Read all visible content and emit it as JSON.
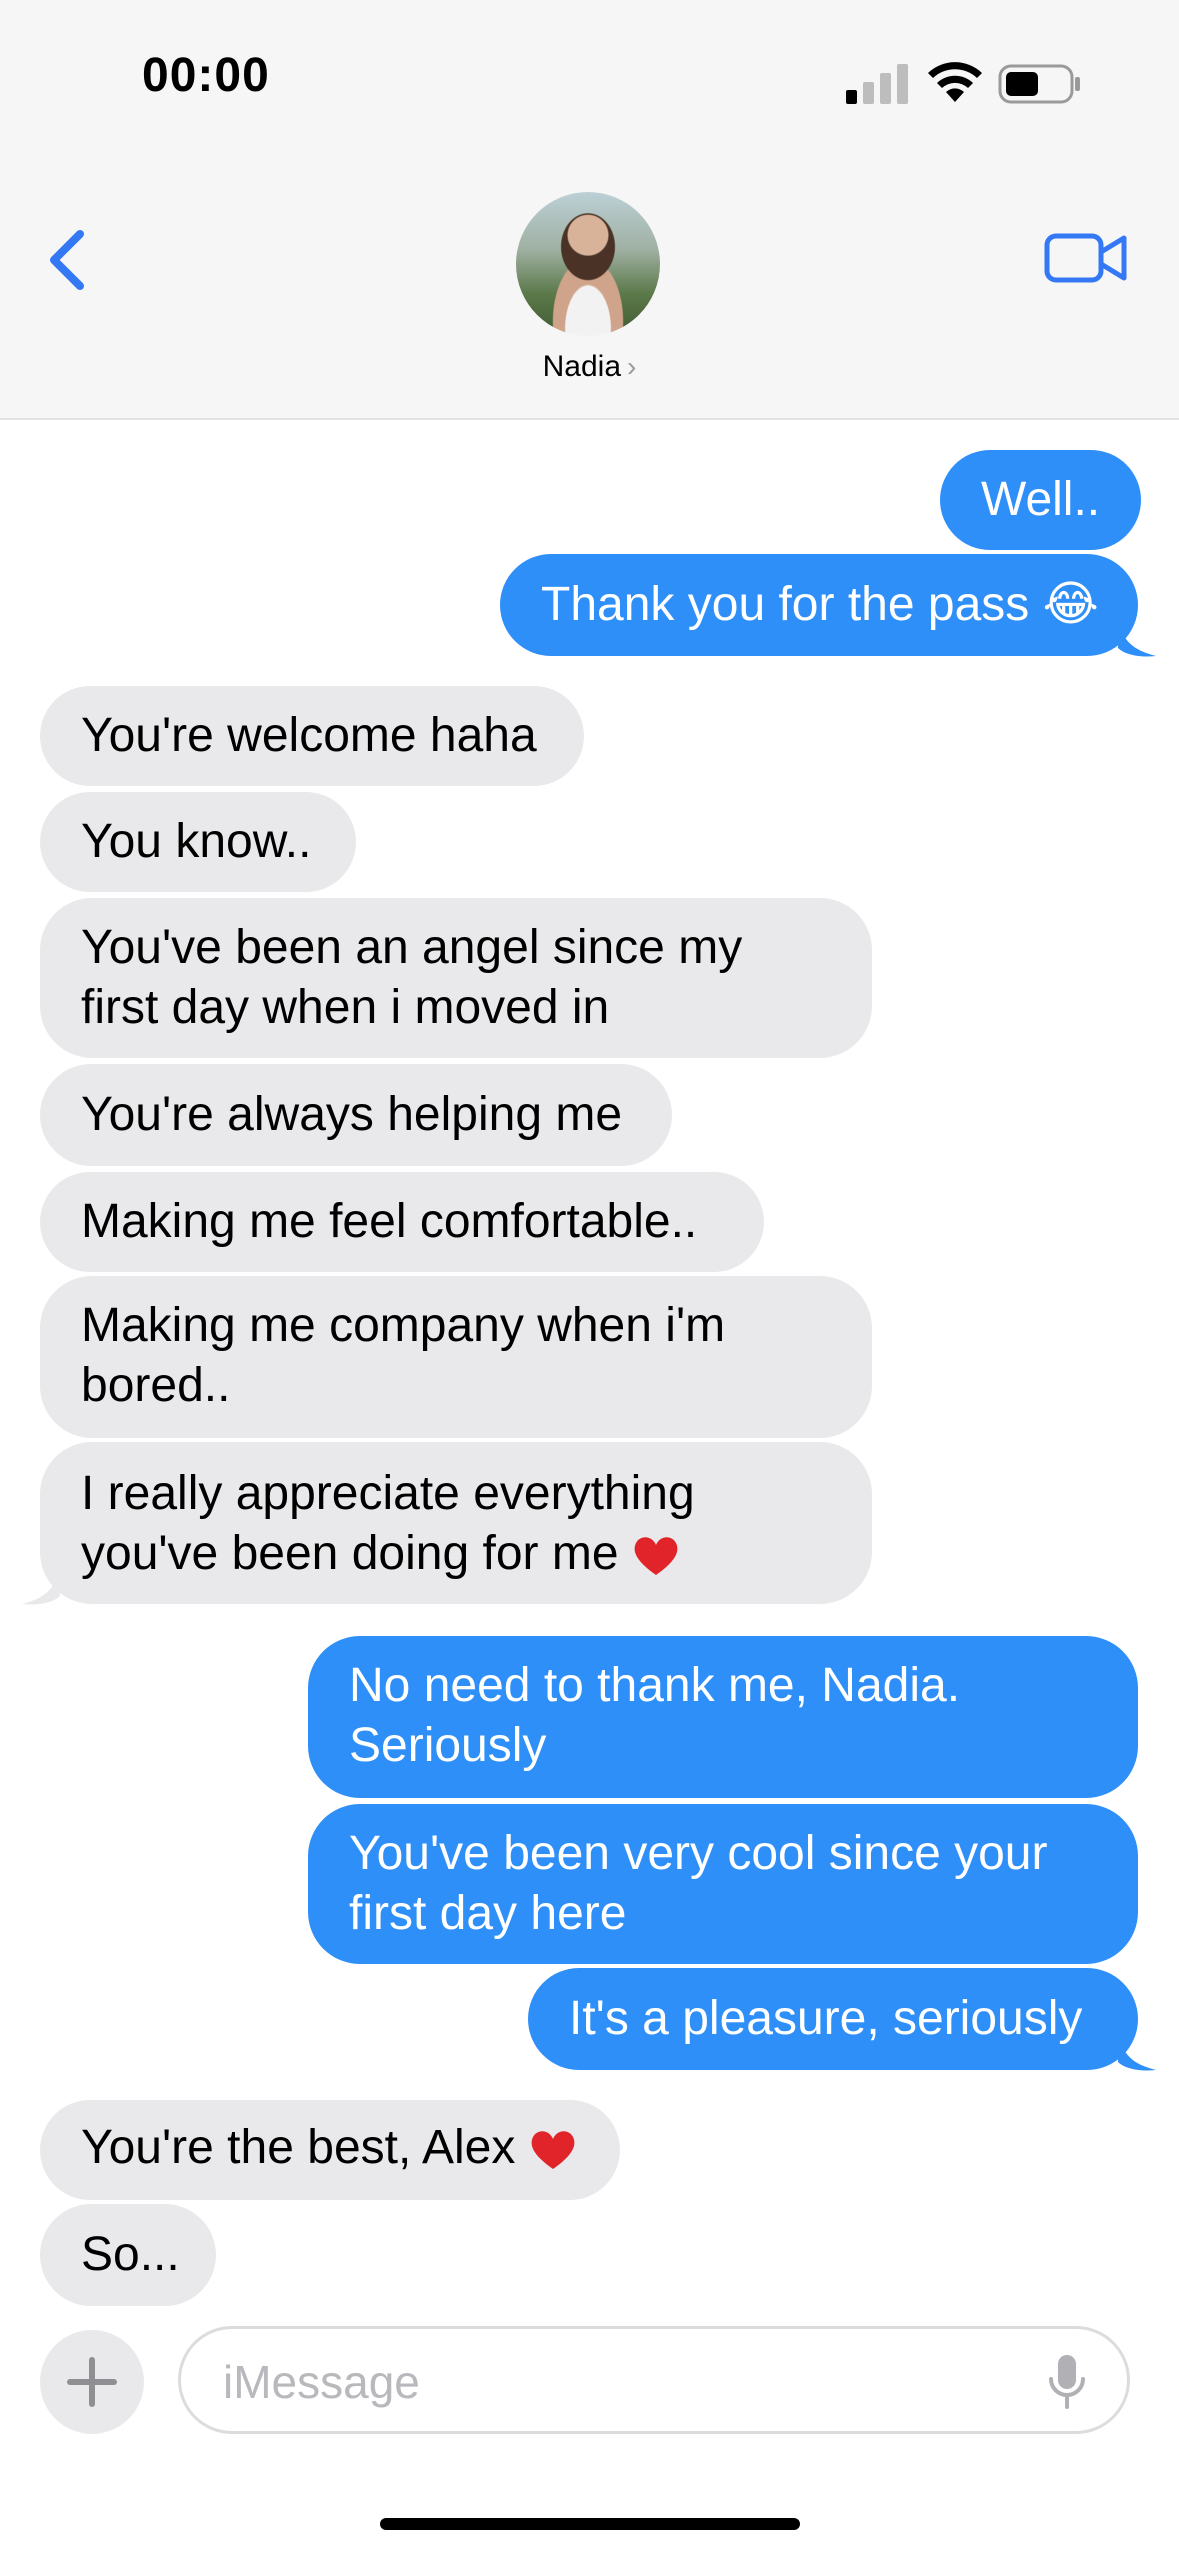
{
  "status_bar": {
    "time": "00:00"
  },
  "header": {
    "contact_name": "Nadia",
    "chevron": "›"
  },
  "messages": [
    {
      "from": "me",
      "text": "Well.."
    },
    {
      "from": "me",
      "text": "Thank you for the pass 😂"
    },
    {
      "from": "them",
      "text": "You're welcome haha"
    },
    {
      "from": "them",
      "text": "You know.."
    },
    {
      "from": "them",
      "line1": "You've been an angel since my",
      "line2": "first day when i moved in"
    },
    {
      "from": "them",
      "text": "You're always helping me"
    },
    {
      "from": "them",
      "text": "Making me feel comfortable.."
    },
    {
      "from": "them",
      "line1": "Making me company when i'm",
      "line2": "bored.."
    },
    {
      "from": "them",
      "line1": "I really appreciate everything",
      "line2": "you've been doing for me"
    },
    {
      "from": "me",
      "line1": "No need to thank me, Nadia.",
      "line2": "Seriously"
    },
    {
      "from": "me",
      "line1": "You've been very cool since your",
      "line2": "first day here"
    },
    {
      "from": "me",
      "text": "It's a pleasure, seriously"
    },
    {
      "from": "them",
      "text": "You're the best, Alex"
    },
    {
      "from": "them",
      "text": "So..."
    }
  ],
  "compose": {
    "placeholder": "iMessage"
  },
  "colors": {
    "sent": "#2f8ff8",
    "received": "#e9e9eb",
    "accent": "#3478f6"
  },
  "icons": [
    "back-chevron-icon",
    "video-camera-icon",
    "plus-icon",
    "microphone-icon",
    "signal-icon",
    "wifi-icon",
    "battery-icon",
    "heart-emoji",
    "laughing-emoji"
  ]
}
